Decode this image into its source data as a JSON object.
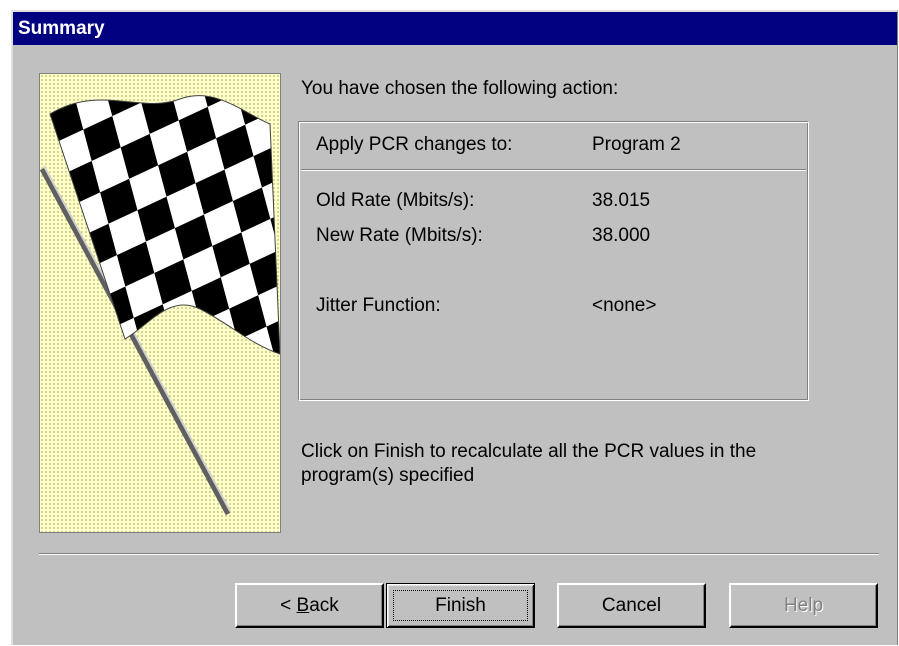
{
  "window": {
    "title": "Summary"
  },
  "intro": "You have chosen the following action:",
  "summary": {
    "header_label": "Apply PCR changes to:",
    "header_value": "Program 2",
    "old_rate_label": "Old Rate (Mbits/s):",
    "old_rate_value": "38.015",
    "new_rate_label": "New Rate (Mbits/s):",
    "new_rate_value": "38.000",
    "jitter_label": "Jitter Function:",
    "jitter_value": "<none>"
  },
  "instruction": "Click on Finish to recalculate all the PCR values in the program(s) specified",
  "buttons": {
    "back_prefix": "< ",
    "back_mnemonic": "B",
    "back_rest": "ack",
    "finish": "Finish",
    "cancel": "Cancel",
    "help": "Help"
  },
  "colors": {
    "titlebar": "#000080",
    "face": "#c0c0c0",
    "panel": "#ffffcc"
  },
  "icons": {
    "wizard_graphic": "checkered-flag-icon"
  }
}
